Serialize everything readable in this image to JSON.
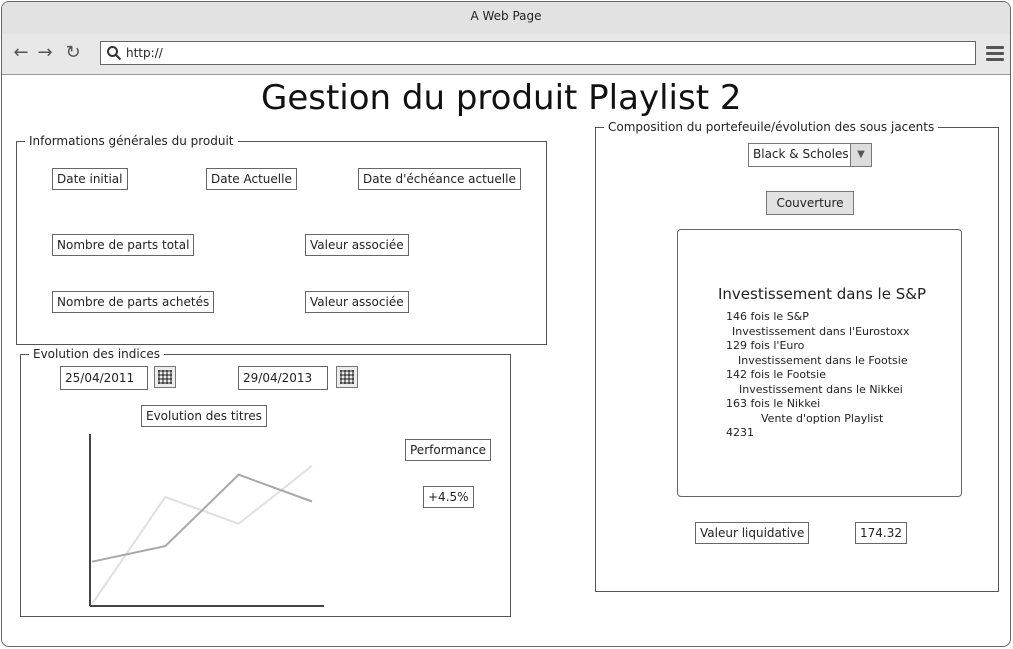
{
  "window": {
    "title": "A Web Page"
  },
  "browser": {
    "url": "http://"
  },
  "page": {
    "title": "Gestion du produit Playlist 2"
  },
  "info": {
    "legend": "Informations générales du produit",
    "date_initial": "Date initial",
    "date_actuelle": "Date Actuelle",
    "date_echeance": "Date d'échéance actuelle",
    "parts_total": "Nombre de parts total",
    "valeur_associee_1": "Valeur associée",
    "parts_achetes": "Nombre de parts achetés",
    "valeur_associee_2": "Valeur associée"
  },
  "evolution": {
    "legend": "Evolution des indices",
    "date_start": "25/04/2011",
    "date_end": "29/04/2013",
    "titres_label": "Evolution des titres",
    "performance_label": "Performance",
    "performance_value": "+4.5%"
  },
  "chart_data": {
    "type": "line",
    "series": [
      {
        "color": "#e0e0e0",
        "values": [
          0,
          48,
          36,
          62
        ]
      },
      {
        "color": "#a8a8a8",
        "values": [
          19,
          26,
          58,
          46
        ]
      }
    ],
    "ylim": [
      0,
      70
    ]
  },
  "composition": {
    "legend": "Composition du portefeuile/évolution des sous jacents",
    "model_select": "Black & Scholes",
    "couverture_button": "Couverture",
    "panel_title": "Investissement dans le S&P",
    "lines": [
      "146 fois le S&P",
      "Investissement dans l'Eurostoxx",
      "129 fois l'Euro",
      "Investissement dans le Footsie",
      "142 fois le Footsie",
      "Investissement dans le Nikkei",
      "163 fois le Nikkei",
      "Vente d'option Playlist",
      "4231"
    ],
    "valeur_liquidative_label": "Valeur liquidative",
    "valeur_liquidative_value": "174.32"
  },
  "icons": {
    "back": "arrow-left-icon",
    "forward": "arrow-right-icon",
    "reload": "reload-icon",
    "search": "search-icon",
    "menu": "hamburger-menu-icon",
    "calendar": "calendar-icon",
    "dropdown": "chevron-down-icon"
  }
}
